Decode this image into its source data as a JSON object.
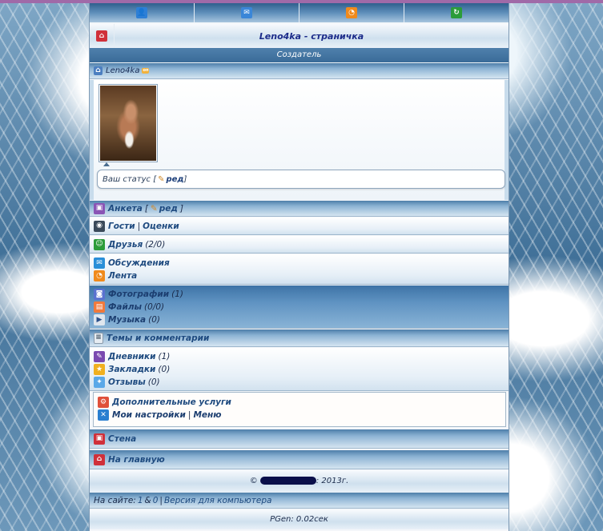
{
  "topnav": [
    {
      "icon": "user-icon",
      "color": "#2d7fd6"
    },
    {
      "icon": "mail-icon",
      "color": "#2d7fd6"
    },
    {
      "icon": "rss-icon",
      "color": "#f08a1c"
    },
    {
      "icon": "refresh-icon",
      "color": "#2c9c3a"
    }
  ],
  "title": "Leno4ka - страничка",
  "creator_label": "Создатель",
  "username": "Leno4ka",
  "status": {
    "prefix": "Ваш статус [",
    "edit": "ред",
    "suffix": "]"
  },
  "menu": {
    "anketa": {
      "label": "Анкета",
      "edit": "ред"
    },
    "guests": {
      "label": "Гости",
      "sep": "|",
      "label2": "Оценки"
    },
    "friends": {
      "label": "Друзья",
      "count": "(2/0)"
    },
    "discussions": {
      "label": "Обсуждения"
    },
    "feed": {
      "label": "Лента"
    },
    "photos": {
      "label": "Фотографии",
      "count": "(1)"
    },
    "files": {
      "label": "Файлы",
      "count": "(0/0)"
    },
    "music": {
      "label": "Музыка",
      "count": "(0)"
    },
    "topics": {
      "label": "Темы и комментарии"
    },
    "diaries": {
      "label": "Дневники",
      "count": "(1)"
    },
    "bookmarks": {
      "label": "Закладки",
      "count": "(0)"
    },
    "reviews": {
      "label": "Отзывы",
      "count": "(0)"
    },
    "services": {
      "label": "Дополнительные услуги"
    },
    "settings": {
      "label": "Мои настройки",
      "sep": "|",
      "label2": "Меню"
    },
    "wall": {
      "label": "Стена"
    },
    "home": {
      "label": "На главную"
    }
  },
  "footer": {
    "copyright_prefix": "©",
    "copyright_suffix": ": 2013г.",
    "online_label": "На сайте:",
    "online_1": "1",
    "amp": "&",
    "online_2": "0",
    "sep": "|",
    "desktop": "Версия для компьютера",
    "pgen": "PGen: 0.02сек"
  }
}
